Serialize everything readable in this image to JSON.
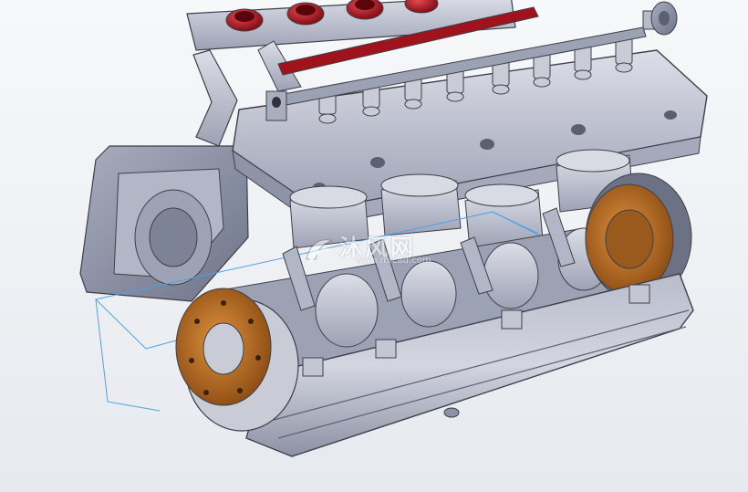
{
  "scene": {
    "subject": "engine-cad-assembly",
    "colors": {
      "background": "#eef0f4",
      "metal": "#c4c7d3",
      "metal_dark": "#8e92a6",
      "copper": "#b96a24",
      "red": "#a60f1a",
      "outline": "#3d4048",
      "selection": "#4aa3e8"
    }
  },
  "watermark": {
    "logo_text": "沐风网",
    "url_text": "www.mfcad.com"
  }
}
